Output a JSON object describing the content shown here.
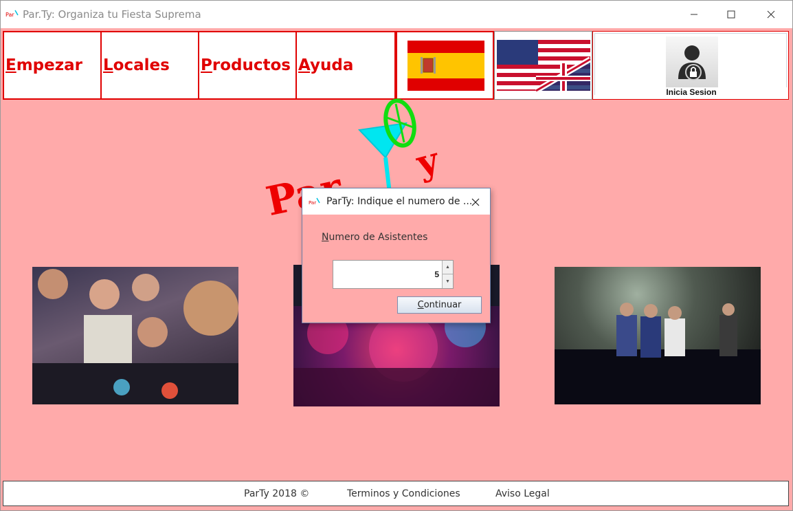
{
  "window": {
    "title": "Par.Ty: Organiza tu Fiesta Suprema",
    "min_icon": "minimize-icon",
    "max_icon": "maximize-icon",
    "close_icon": "close-icon"
  },
  "menu": {
    "items": [
      {
        "label": "Empezar"
      },
      {
        "label": "Locales"
      },
      {
        "label": "Productos"
      },
      {
        "label": "Ayuda"
      }
    ]
  },
  "language": {
    "es_icon": "spain-flag-icon",
    "en_icon": "usa-uk-flag-icon"
  },
  "login": {
    "label": "Inicia Sesion",
    "icon": "user-lock-icon"
  },
  "logo": {
    "text_left": "Par",
    "text_right": "y"
  },
  "dialog": {
    "title": "ParTy: Indique el numero de ...",
    "label": "Numero de Asistentes",
    "spinner_value": "5",
    "continue_label": "Continuar"
  },
  "footer": {
    "copyright": "ParTy 2018 ©",
    "terms": "Terminos y Condiciones",
    "legal": "Aviso Legal"
  },
  "colors": {
    "background": "#ffaaaa",
    "accent": "#e00000"
  }
}
